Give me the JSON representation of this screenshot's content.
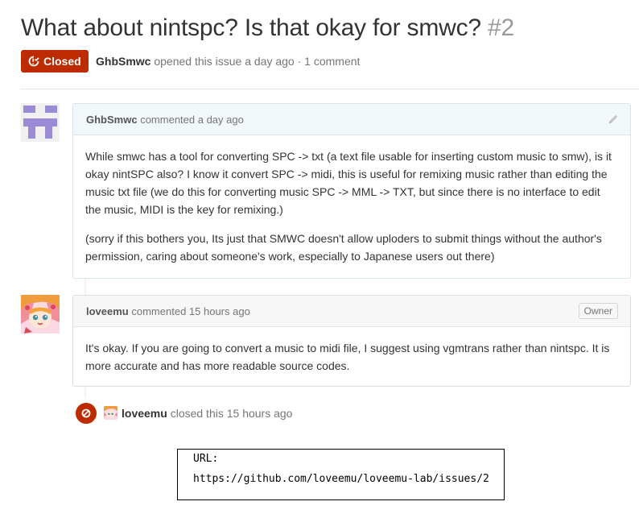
{
  "issue": {
    "title": "What about nintspc? Is that okay for smwc?",
    "number": "#2",
    "state_label": "Closed",
    "author": "GhbSmwc",
    "opened_text": "opened this issue a day ago",
    "separator": "·",
    "comment_count": "1 comment"
  },
  "comments": [
    {
      "author": "GhbSmwc",
      "action": "commented a day ago",
      "paragraphs": [
        "While smwc has a tool for converting SPC -> txt (a text file usable for inserting custom music to smw), is it okay nintSPC also? I know it convert SPC -> midi, this is useful for remixing music rather than editing the music txt file (we do this for converting music SPC -> MML -> TXT, but since there is no interface to edit the music, MIDI is the key for remixing.)",
        "(sorry if this bothers you, Its just that SMWC doesn't allow uploders to submit things without the author's permission, caring about someone's work, especially to Japanese users out there)"
      ]
    },
    {
      "author": "loveemu",
      "action": "commented 15 hours ago",
      "badge": "Owner",
      "paragraphs": [
        "It's okay. If you are going to convert a music to midi file, I suggest using vgmtrans rather than nintspc. It is more accurate and has more readable source codes."
      ]
    }
  ],
  "closed_event": {
    "actor": "loveemu",
    "text": "closed this 15 hours ago"
  },
  "url_box": {
    "label": "URL:",
    "value": "https://github.com/loveemu/loveemu-lab/issues/2"
  },
  "colors": {
    "closed_red": "#bd2c00",
    "identicon_purple": "#9b8bd6"
  }
}
